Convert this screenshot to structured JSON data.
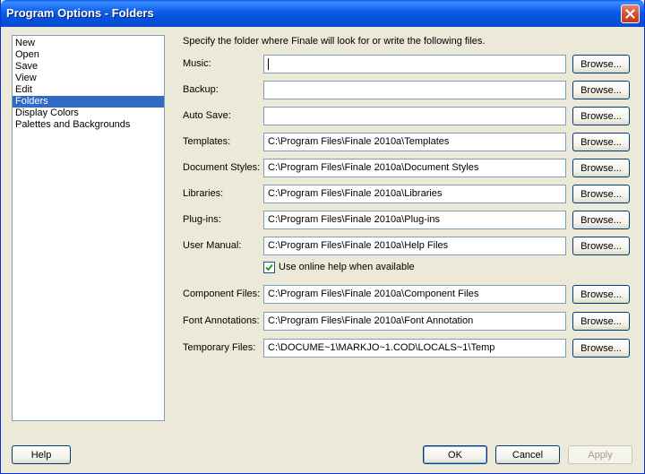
{
  "window": {
    "title": "Program Options - Folders"
  },
  "sidebar": {
    "items": [
      {
        "label": "New",
        "selected": false
      },
      {
        "label": "Open",
        "selected": false
      },
      {
        "label": "Save",
        "selected": false
      },
      {
        "label": "View",
        "selected": false
      },
      {
        "label": "Edit",
        "selected": false
      },
      {
        "label": "Folders",
        "selected": true
      },
      {
        "label": "Display Colors",
        "selected": false
      },
      {
        "label": "Palettes and Backgrounds",
        "selected": false
      }
    ]
  },
  "main": {
    "instruction": "Specify the folder where Finale will look for or write the following files.",
    "browse_label": "Browse...",
    "folders": [
      {
        "label": "Music:",
        "value": ""
      },
      {
        "label": "Backup:",
        "value": ""
      },
      {
        "label": "Auto Save:",
        "value": ""
      },
      {
        "label": "Templates:",
        "value": "C:\\Program Files\\Finale 2010a\\Templates"
      },
      {
        "label": "Document Styles:",
        "value": "C:\\Program Files\\Finale 2010a\\Document Styles"
      },
      {
        "label": "Libraries:",
        "value": "C:\\Program Files\\Finale 2010a\\Libraries"
      },
      {
        "label": "Plug-ins:",
        "value": "C:\\Program Files\\Finale 2010a\\Plug-ins"
      },
      {
        "label": "User Manual:",
        "value": "C:\\Program Files\\Finale 2010a\\Help Files"
      },
      {
        "label": "Component Files:",
        "value": "C:\\Program Files\\Finale 2010a\\Component Files"
      },
      {
        "label": "Font Annotations:",
        "value": "C:\\Program Files\\Finale 2010a\\Font Annotation"
      },
      {
        "label": "Temporary Files:",
        "value": "C:\\DOCUME~1\\MARKJO~1.COD\\LOCALS~1\\Temp"
      }
    ],
    "online_help": {
      "label": "Use online help when available",
      "checked": true
    }
  },
  "footer": {
    "help_label": "Help",
    "ok_label": "OK",
    "cancel_label": "Cancel",
    "apply_label": "Apply"
  },
  "colors": {
    "titlebar": "#0552dc",
    "selection": "#316ac5",
    "checkmark": "#21a121"
  }
}
